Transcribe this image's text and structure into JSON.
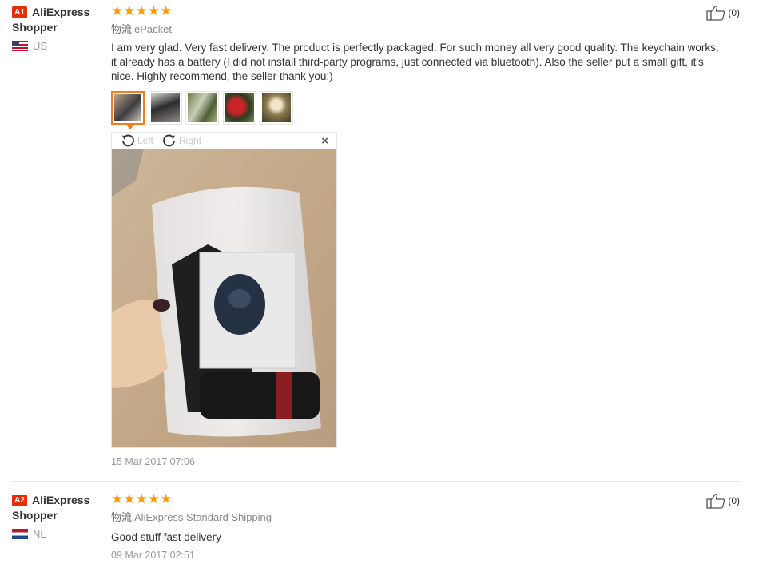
{
  "reviews": [
    {
      "badge": "A1",
      "user_name": "AliExpress Shopper",
      "country": "US",
      "rating": "★★★★★",
      "logistics_label": "物流",
      "logistics_value": "ePacket",
      "feedback": "I am very glad. Very fast delivery. The product is perfectly packaged. For such money all very good quality. The keychain works, it already has a battery (I did not install third-party programs, just connected via bluetooth). Also the seller put a small gift, it's nice. Highly recommend, the seller thank you;)",
      "date": "15 Mar 2017 07:06",
      "likes": "(0)",
      "viewer": {
        "rotate_left": "Left",
        "rotate_right": "Right",
        "close": "×"
      }
    },
    {
      "badge": "A2",
      "user_name": "AliExpress Shopper",
      "country": "NL",
      "rating": "★★★★★",
      "logistics_label": "物流",
      "logistics_value": "AliExpress Standard Shipping",
      "feedback": "Good stuff fast delivery",
      "date": "09 Mar 2017 02:51",
      "likes": "(0)"
    }
  ],
  "colors": {
    "badge": "#e62e04",
    "stars": "#ff9a00",
    "active_thumb": "#f07c1e"
  },
  "icons": [
    "flag-us-icon",
    "flag-nl-icon",
    "thumbs-up-icon",
    "rotate-left-icon",
    "rotate-right-icon",
    "close-icon"
  ]
}
